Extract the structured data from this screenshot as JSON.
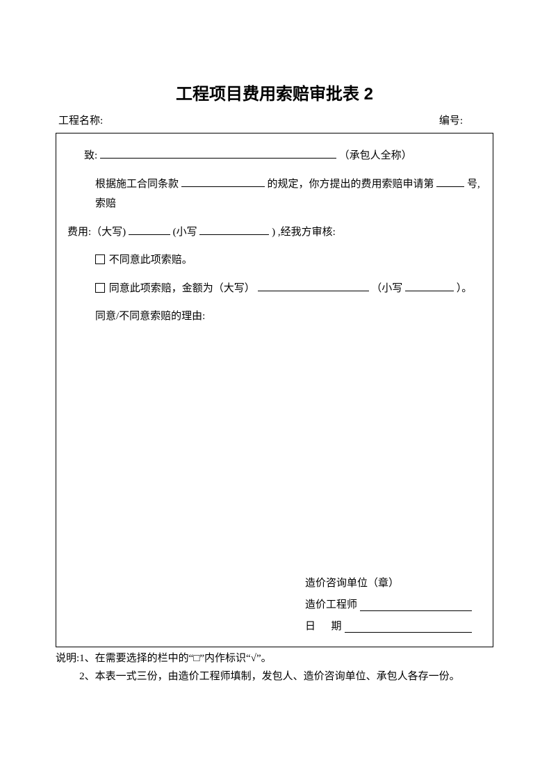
{
  "title": "工程项目费用索赔审批表 2",
  "header": {
    "left": "工程名称:",
    "right": "编号:"
  },
  "body": {
    "to_prefix": "致:",
    "to_suffix": "（承包人全称）",
    "para1_a": "根据施工合同条款",
    "para1_b": "的规定，你方提出的费用索赔申请第",
    "para1_c": "号,索赔",
    "para2_a": "费用:（大写)",
    "para2_b": "(小写",
    "para2_c": ") ,经我方审核:",
    "opt1": "不同意此项索赔。",
    "opt2_a": "同意此项索赔，金额为（大写）",
    "opt2_b": "（小写",
    "opt2_c": "）。",
    "reason": "同意/不同意索赔的理由:"
  },
  "footer": {
    "unit": "造价咨询单位（章）",
    "engineer": "造价工程师",
    "date_label_a": "日",
    "date_label_b": "期"
  },
  "notes": {
    "label": "说明:",
    "item1": "1、在需要选择的栏中的“□”内作标识“√”。",
    "item2": "2、本表一式三份，由造价工程师填制，发包人、造价咨询单位、承包人各存一份。"
  }
}
